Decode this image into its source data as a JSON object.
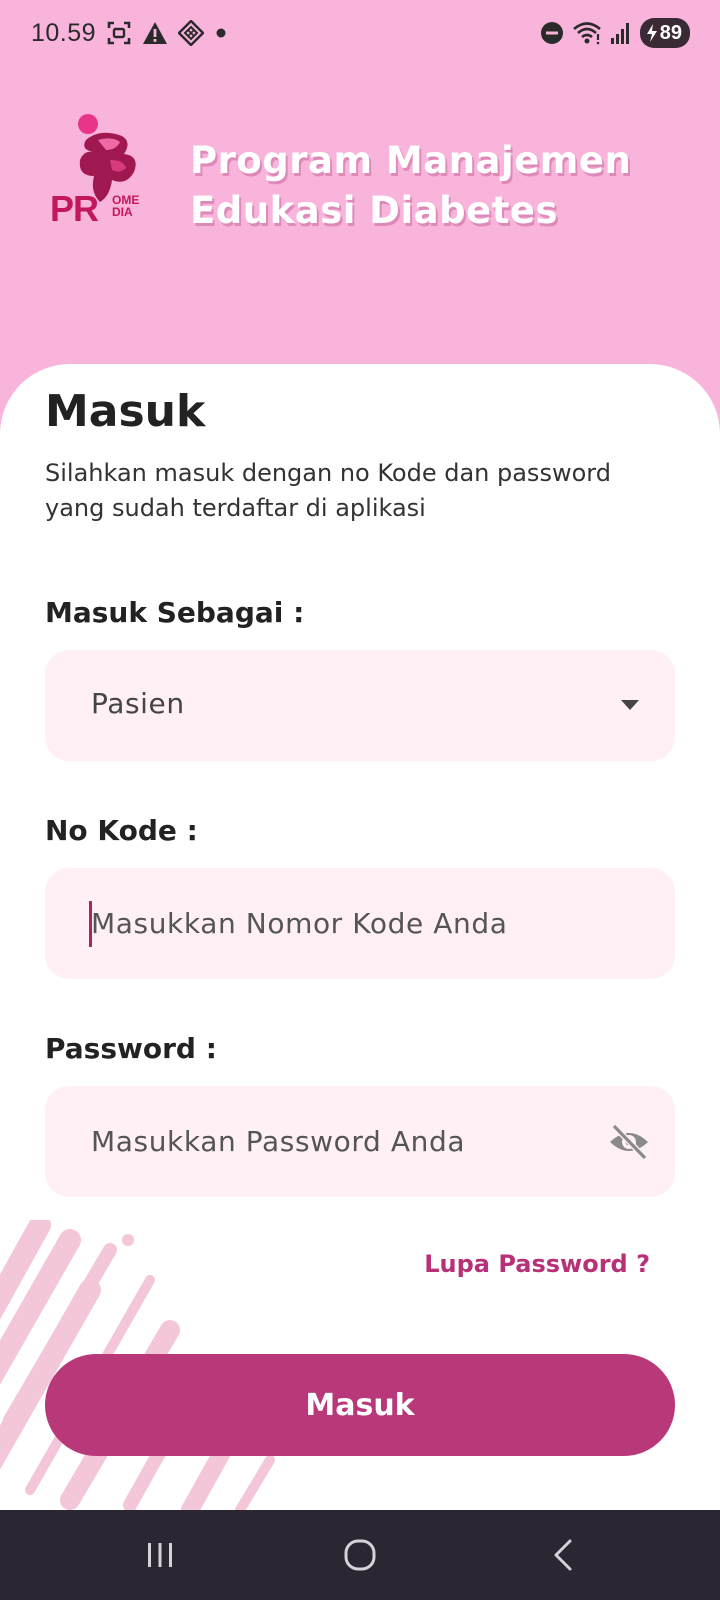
{
  "status_bar": {
    "time": "10.59",
    "battery_level": "89",
    "icons": [
      "screenshot-icon",
      "warning-icon",
      "app-icon",
      "dot-icon",
      "do-not-disturb-icon",
      "wifi-icon",
      "signal-icon",
      "battery-icon"
    ]
  },
  "header": {
    "logo_text": "PR",
    "logo_sub_1": "OME",
    "logo_sub_2": "DIA",
    "title_line_1": "Program Manajemen",
    "title_line_2": "Edukasi Diabetes"
  },
  "login": {
    "title": "Masuk",
    "subtitle": "Silahkan masuk dengan no Kode dan password yang sudah terdaftar di aplikasi",
    "role_label": "Masuk Sebagai :",
    "role_value": "Pasien",
    "code_label": "No Kode :",
    "code_placeholder": "Masukkan Nomor Kode Anda",
    "password_label": "Password :",
    "password_placeholder": "Masukkan Password Anda",
    "forgot_password": "Lupa Password ?",
    "submit_label": "Masuk"
  },
  "colors": {
    "background": "#f9b4dc",
    "accent": "#b8387a",
    "field_bg": "#fff0f6"
  }
}
